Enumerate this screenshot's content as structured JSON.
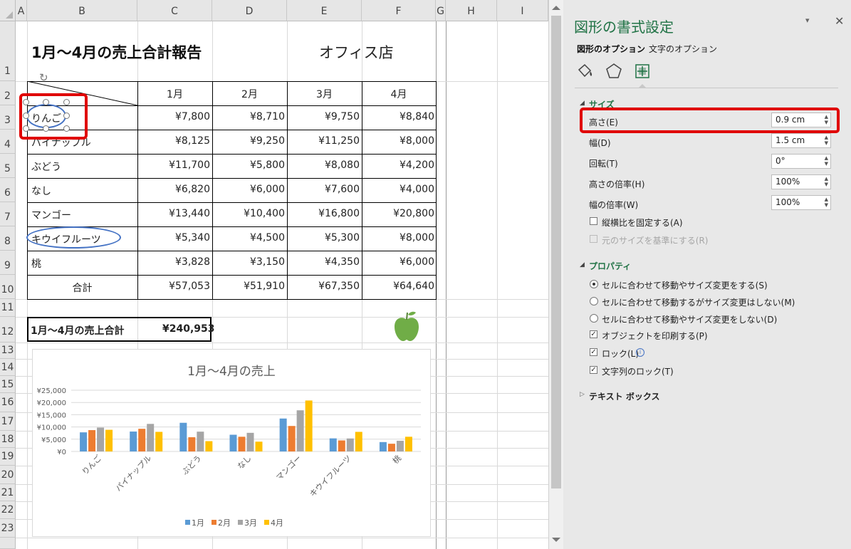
{
  "sheet": {
    "columns": [
      "A",
      "B",
      "C",
      "D",
      "E",
      "F",
      "G",
      "H",
      "I"
    ],
    "rows": [
      "1",
      "2",
      "3",
      "4",
      "5",
      "6",
      "7",
      "8",
      "9",
      "10",
      "11",
      "12",
      "13",
      "14",
      "15",
      "16",
      "17",
      "18",
      "19",
      "20",
      "21",
      "22",
      "23"
    ],
    "title": "1月～4月の売上合計報告",
    "store": "オフィス店",
    "table": {
      "months": [
        "1月",
        "2月",
        "3月",
        "4月"
      ],
      "items": [
        {
          "name": "りんご",
          "values": [
            "¥7,800",
            "¥8,710",
            "¥9,750",
            "¥8,840"
          ]
        },
        {
          "name": "パイナップル",
          "values": [
            "¥8,125",
            "¥9,250",
            "¥11,250",
            "¥8,000"
          ]
        },
        {
          "name": "ぶどう",
          "values": [
            "¥11,700",
            "¥5,800",
            "¥8,080",
            "¥4,200"
          ]
        },
        {
          "name": "なし",
          "values": [
            "¥6,820",
            "¥6,000",
            "¥7,600",
            "¥4,000"
          ]
        },
        {
          "name": "マンゴー",
          "values": [
            "¥13,440",
            "¥10,400",
            "¥16,800",
            "¥20,800"
          ]
        },
        {
          "name": "キウイフルーツ",
          "values": [
            "¥5,340",
            "¥4,500",
            "¥5,300",
            "¥8,000"
          ]
        },
        {
          "name": "桃",
          "values": [
            "¥3,828",
            "¥3,150",
            "¥4,350",
            "¥6,000"
          ]
        }
      ],
      "total_label": "合計",
      "totals": [
        "¥57,053",
        "¥51,910",
        "¥67,350",
        "¥64,640"
      ]
    },
    "summary": {
      "label": "1月～4月の売上合計",
      "value": "¥240,953"
    },
    "icons": {
      "apple": "apple-icon"
    }
  },
  "chart_data": {
    "type": "bar",
    "title": "1月～4月の売上",
    "categories": [
      "りんご",
      "パイナップル",
      "ぶどう",
      "なし",
      "マンゴー",
      "キウイフルーツ",
      "桃"
    ],
    "series": [
      {
        "name": "1月",
        "color": "#5b9bd5",
        "values": [
          7800,
          8125,
          11700,
          6820,
          13440,
          5340,
          3828
        ]
      },
      {
        "name": "2月",
        "color": "#ed7d31",
        "values": [
          8710,
          9250,
          5800,
          6000,
          10400,
          4500,
          3150
        ]
      },
      {
        "name": "3月",
        "color": "#a5a5a5",
        "values": [
          9750,
          11250,
          8080,
          7600,
          16800,
          5300,
          4350
        ]
      },
      {
        "name": "4月",
        "color": "#ffc000",
        "values": [
          8840,
          8000,
          4200,
          4000,
          20800,
          8000,
          6000
        ]
      }
    ],
    "yticks": [
      "¥0",
      "¥5,000",
      "¥10,000",
      "¥15,000",
      "¥20,000",
      "¥25,000"
    ],
    "ylim": [
      0,
      25000
    ],
    "grid": true,
    "legend": "bottom"
  },
  "panel": {
    "title": "図形の書式設定",
    "tabs": [
      "図形のオプション",
      "文字のオプション"
    ],
    "icons": [
      "fill-line-icon",
      "effects-pentagon-icon",
      "size-properties-icon"
    ],
    "size_section": "サイズ",
    "fields": [
      {
        "label": "高さ(E)",
        "value": "0.9 cm"
      },
      {
        "label": "幅(D)",
        "value": "1.5 cm"
      },
      {
        "label": "回転(T)",
        "value": "0°"
      },
      {
        "label": "高さの倍率(H)",
        "value": "100%"
      },
      {
        "label": "幅の倍率(W)",
        "value": "100%"
      }
    ],
    "lock_aspect": "縦横比を固定する(A)",
    "relative_original": "元のサイズを基準にする(R)",
    "properties_section": "プロパティ",
    "radios": [
      "セルに合わせて移動やサイズ変更をする(S)",
      "セルに合わせて移動するがサイズ変更はしない(M)",
      "セルに合わせて移動やサイズ変更をしない(D)"
    ],
    "checks": [
      "オブジェクトを印刷する(P)",
      "ロック(L)",
      "文字列のロック(T)"
    ],
    "textbox_section": "テキスト ボックス"
  }
}
